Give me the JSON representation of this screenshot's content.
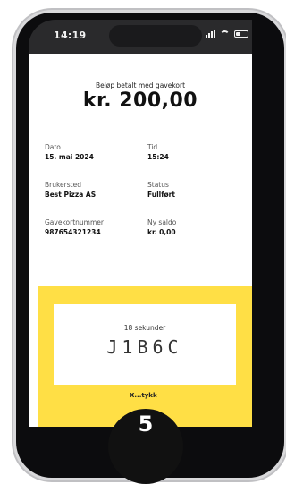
{
  "status_bar": {
    "time": "14:19"
  },
  "receipt": {
    "subtitle": "Beløp betalt med gavekort",
    "amount": "kr. 200,00",
    "fields": [
      {
        "label": "Dato",
        "value": "15. mai 2024"
      },
      {
        "label": "Tid",
        "value": "15:24"
      },
      {
        "label": "Brukersted",
        "value": "Best Pizza AS"
      },
      {
        "label": "Status",
        "value": "Fullført"
      },
      {
        "label": "Gavekortnummer",
        "value": "987654321234"
      },
      {
        "label": "Ny saldo",
        "value": "kr. 0,00"
      }
    ]
  },
  "verification": {
    "seconds_text": "18 sekunder",
    "code": "J1B6C",
    "bottom_label": "X...tykk",
    "accent_color": "#ffdf45"
  },
  "step": {
    "number": "5"
  }
}
